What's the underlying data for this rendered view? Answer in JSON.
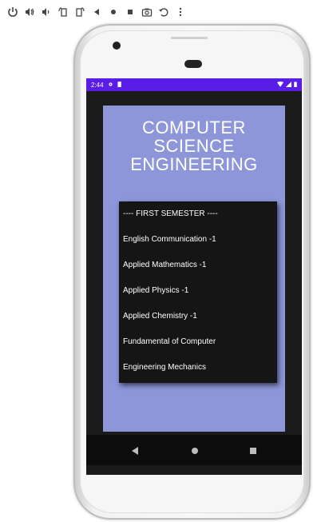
{
  "toolbar": {
    "buttons": [
      "power-icon",
      "volume-up-icon",
      "volume-down-icon",
      "rotate-left-icon",
      "rotate-right-icon",
      "back-icon",
      "home-icon",
      "overview-icon",
      "camera-icon",
      "undo-icon",
      "more-icon"
    ]
  },
  "status_bar": {
    "time": "2:44",
    "background": "#5a1de8"
  },
  "app": {
    "title_lines": [
      "COMPUTER",
      "SCIENCE",
      "ENGINEERING"
    ],
    "card_color": "#8d96d8"
  },
  "dropdown": {
    "items": [
      "---- FIRST SEMESTER ----",
      "English Communication -1",
      "Applied Mathematics -1",
      "Applied Physics -1",
      "Applied Chemistry -1",
      "Fundamental of Computer",
      "Engineering Mechanics"
    ]
  },
  "nav": {
    "buttons": [
      "back-triangle-icon",
      "home-circle-icon",
      "recents-square-icon"
    ]
  }
}
